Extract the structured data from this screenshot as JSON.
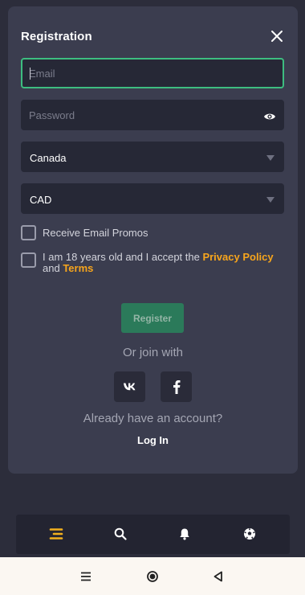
{
  "modal": {
    "title": "Registration",
    "email": {
      "placeholder": "Email",
      "value": ""
    },
    "password": {
      "placeholder": "Password",
      "value": ""
    },
    "country": {
      "selected": "Canada"
    },
    "currency": {
      "selected": "CAD"
    },
    "promos_label": "Receive Email Promos",
    "terms": {
      "text_before": "I am 18 years old and I accept the ",
      "privacy_link": "Privacy Policy",
      "text_and": "and ",
      "terms_link": "Terms"
    },
    "register_label": "Register",
    "or_join": "Or join with",
    "social": [
      "vk-icon",
      "facebook-icon"
    ],
    "already": "Already have an account?",
    "login_label": "Log In"
  },
  "bottom_nav": [
    "menu-icon",
    "search-icon",
    "bell-icon",
    "soccer-ball-icon"
  ],
  "android_nav": [
    "recents-icon",
    "home-icon",
    "back-icon"
  ],
  "colors": {
    "background": "#2c2d3b",
    "modal": "#3b3d4f",
    "input": "#262836",
    "focus_border": "#3dbd80",
    "accent_link": "#f7a51c",
    "register_button": "#2b7a5a",
    "menu_accent": "#f2b01e"
  }
}
